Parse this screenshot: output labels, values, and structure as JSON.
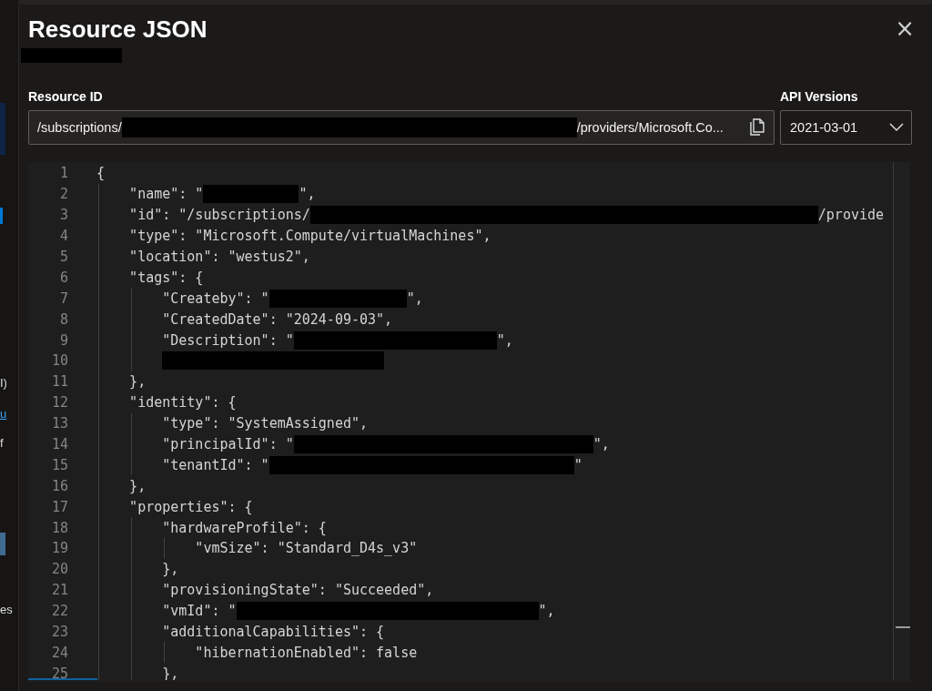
{
  "background_fragments": [
    {
      "text": "I)",
      "kind": "plain"
    },
    {
      "text": "u",
      "kind": "link"
    },
    {
      "text": "f",
      "kind": "plain"
    },
    {
      "text": "es",
      "kind": "plain"
    }
  ],
  "panel": {
    "title": "Resource JSON",
    "close_label": "×"
  },
  "resource_id": {
    "label": "Resource ID",
    "segments": [
      {
        "kind": "text",
        "text": "/subscriptions/"
      },
      {
        "kind": "redacted"
      },
      {
        "kind": "text",
        "text": "/providers/Microsoft.Co..."
      }
    ]
  },
  "api_versions": {
    "label": "API Versions",
    "value": "2021-03-01"
  },
  "editor": {
    "lines": [
      {
        "number": "1",
        "segments": [
          {
            "kind": "text",
            "text": "{"
          }
        ]
      },
      {
        "number": "2",
        "segments": [
          {
            "kind": "text",
            "text": "    \"name\": \""
          },
          {
            "kind": "redacted"
          },
          {
            "kind": "text",
            "text": "\","
          }
        ]
      },
      {
        "number": "3",
        "segments": [
          {
            "kind": "text",
            "text": "    \"id\": \"/subscriptions/"
          },
          {
            "kind": "redacted"
          },
          {
            "kind": "text",
            "text": "/provide"
          }
        ]
      },
      {
        "number": "4",
        "segments": [
          {
            "kind": "text",
            "text": "    \"type\": \"Microsoft.Compute/virtualMachines\","
          }
        ]
      },
      {
        "number": "5",
        "segments": [
          {
            "kind": "text",
            "text": "    \"location\": \"westus2\","
          }
        ]
      },
      {
        "number": "6",
        "segments": [
          {
            "kind": "text",
            "text": "    \"tags\": {"
          }
        ]
      },
      {
        "number": "7",
        "segments": [
          {
            "kind": "text",
            "text": "        \"Createby\": \""
          },
          {
            "kind": "redacted"
          },
          {
            "kind": "text",
            "text": "\","
          }
        ]
      },
      {
        "number": "8",
        "segments": [
          {
            "kind": "text",
            "text": "        \"CreatedDate\": \"2024-09-03\","
          }
        ]
      },
      {
        "number": "9",
        "segments": [
          {
            "kind": "text",
            "text": "        \"Description\": \""
          },
          {
            "kind": "redacted"
          },
          {
            "kind": "text",
            "text": "\","
          }
        ]
      },
      {
        "number": "10",
        "segments": [
          {
            "kind": "redacted"
          }
        ]
      },
      {
        "number": "11",
        "segments": [
          {
            "kind": "text",
            "text": "    },"
          }
        ]
      },
      {
        "number": "12",
        "segments": [
          {
            "kind": "text",
            "text": "    \"identity\": {"
          }
        ]
      },
      {
        "number": "13",
        "segments": [
          {
            "kind": "text",
            "text": "        \"type\": \"SystemAssigned\","
          }
        ]
      },
      {
        "number": "14",
        "segments": [
          {
            "kind": "text",
            "text": "        \"principalId\": \""
          },
          {
            "kind": "redacted"
          },
          {
            "kind": "text",
            "text": "\","
          }
        ]
      },
      {
        "number": "15",
        "segments": [
          {
            "kind": "text",
            "text": "        \"tenantId\": \""
          },
          {
            "kind": "redacted"
          },
          {
            "kind": "text",
            "text": "\""
          }
        ]
      },
      {
        "number": "16",
        "segments": [
          {
            "kind": "text",
            "text": "    },"
          }
        ]
      },
      {
        "number": "17",
        "segments": [
          {
            "kind": "text",
            "text": "    \"properties\": {"
          }
        ]
      },
      {
        "number": "18",
        "segments": [
          {
            "kind": "text",
            "text": "        \"hardwareProfile\": {"
          }
        ]
      },
      {
        "number": "19",
        "segments": [
          {
            "kind": "text",
            "text": "            \"vmSize\": \"Standard_D4s_v3\""
          }
        ]
      },
      {
        "number": "20",
        "segments": [
          {
            "kind": "text",
            "text": "        },"
          }
        ]
      },
      {
        "number": "21",
        "segments": [
          {
            "kind": "text",
            "text": "        \"provisioningState\": \"Succeeded\","
          }
        ]
      },
      {
        "number": "22",
        "segments": [
          {
            "kind": "text",
            "text": "        \"vmId\": \""
          },
          {
            "kind": "redacted"
          },
          {
            "kind": "text",
            "text": "\","
          }
        ]
      },
      {
        "number": "23",
        "segments": [
          {
            "kind": "text",
            "text": "        \"additionalCapabilities\": {"
          }
        ]
      },
      {
        "number": "24",
        "segments": [
          {
            "kind": "text",
            "text": "            \"hibernationEnabled\": false"
          }
        ]
      },
      {
        "number": "25",
        "segments": [
          {
            "kind": "text",
            "text": "        },"
          }
        ]
      }
    ]
  }
}
